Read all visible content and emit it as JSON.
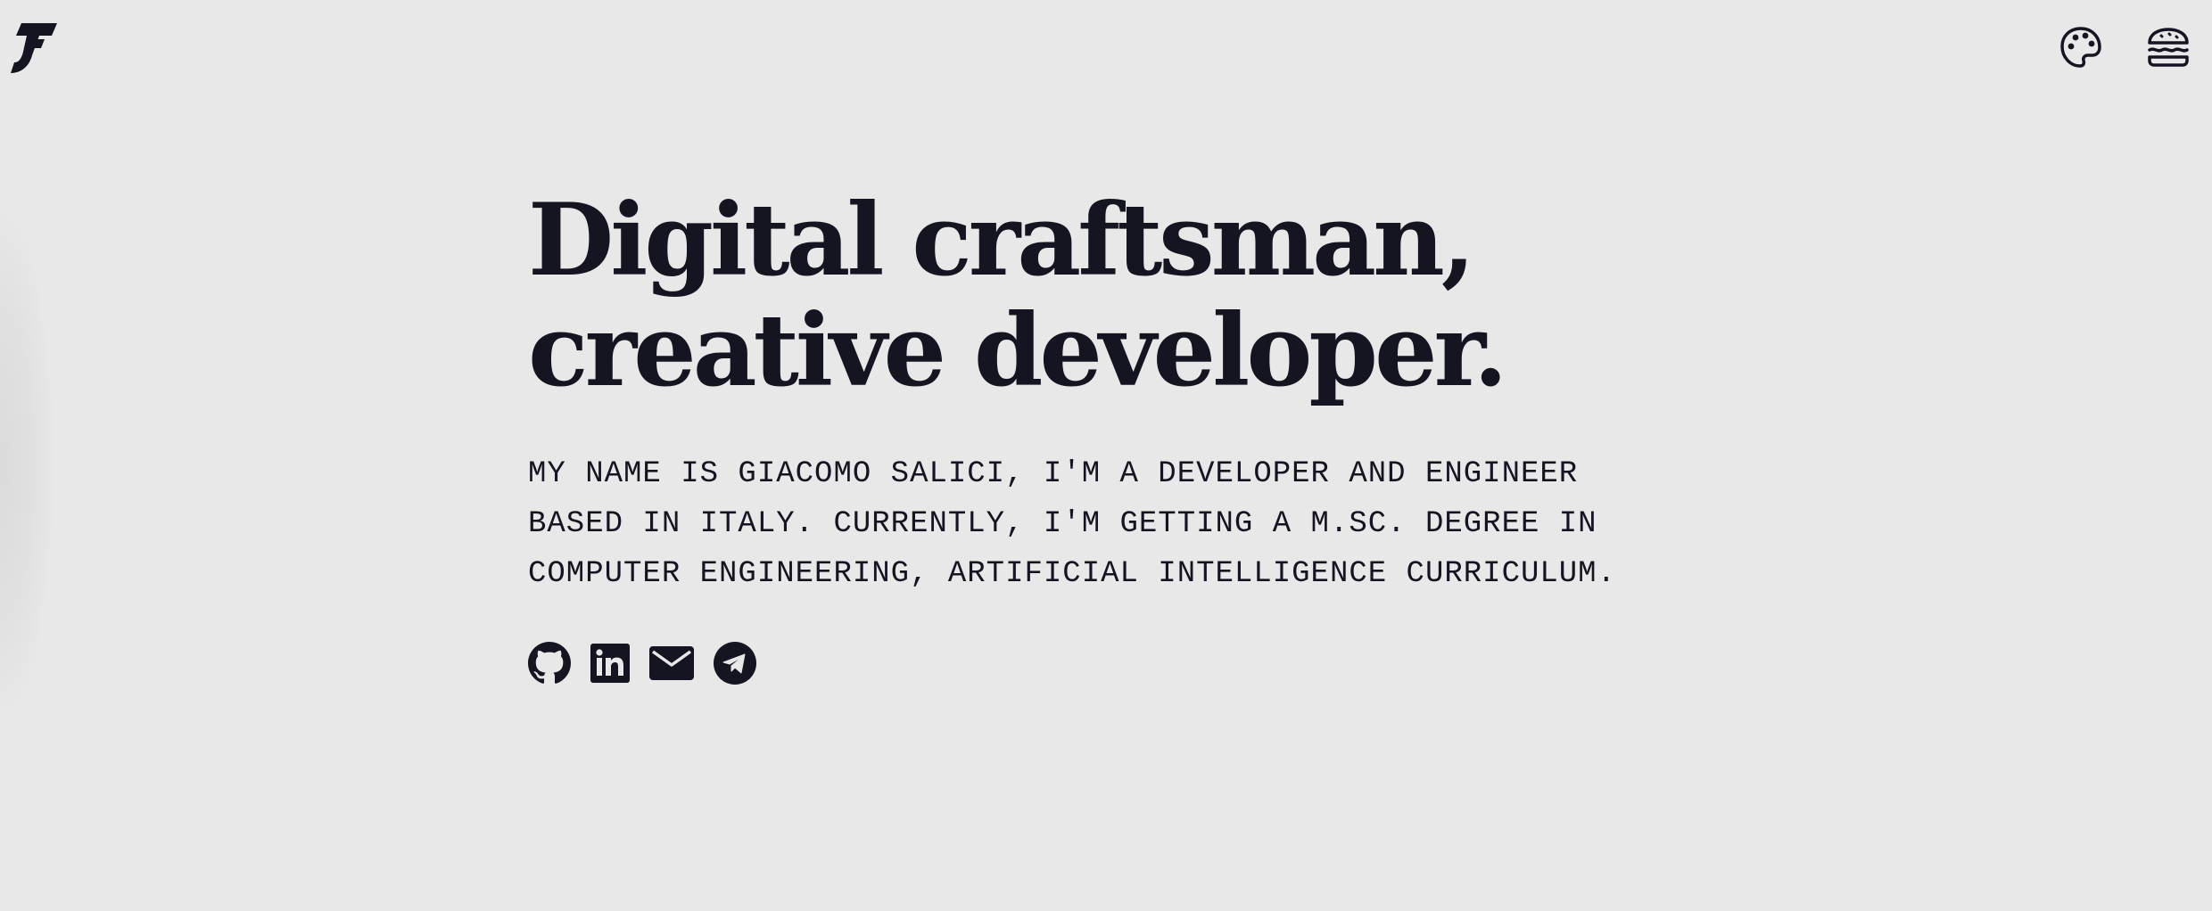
{
  "colors": {
    "background": "#e8e8e8",
    "foreground": "#151522"
  },
  "header": {
    "logo_icon": "brand-logo-icon",
    "actions": [
      {
        "icon": "palette-icon"
      },
      {
        "icon": "hamburger-menu-icon"
      }
    ]
  },
  "hero": {
    "headline_line_1": "Digital craftsman,",
    "headline_line_2": "creative developer.",
    "bio_lines": [
      "MY NAME IS GIACOMO SALICI, I'M A DEVELOPER AND ENGINEER",
      "BASED IN ITALY. CURRENTLY, I'M GETTING A M.SC. DEGREE IN",
      "COMPUTER ENGINEERING, ARTIFICIAL INTELLIGENCE CURRICULUM."
    ]
  },
  "socials": [
    {
      "icon": "github-icon"
    },
    {
      "icon": "linkedin-icon"
    },
    {
      "icon": "email-icon"
    },
    {
      "icon": "telegram-icon"
    }
  ]
}
